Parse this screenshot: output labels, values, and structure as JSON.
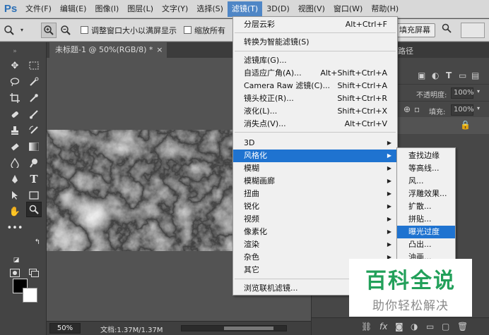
{
  "app": {
    "logo": "Ps"
  },
  "menubar": {
    "items": [
      "文件(F)",
      "编辑(E)",
      "图像(I)",
      "图层(L)",
      "文字(Y)",
      "选择(S)",
      "滤镜(T)",
      "3D(D)",
      "视图(V)",
      "窗口(W)",
      "帮助(H)"
    ],
    "active_index": 6
  },
  "options_bar": {
    "resize_windows_label": "调整窗口大小以满屏显示",
    "zoom_all_label": "缩放所有",
    "fill_screen_label": "填充屏幕"
  },
  "document": {
    "tab_title": "未标题-1 @ 50%(RGB/8) *",
    "close_glyph": "×"
  },
  "status": {
    "zoom": "50%",
    "doc_info": "文档:1.37M/1.37M"
  },
  "right_panel": {
    "tab_label": "路径",
    "opacity_label": "不透明度:",
    "opacity_value": "100%",
    "fill_label": "填充:",
    "fill_value": "100%"
  },
  "filter_menu": {
    "items": [
      {
        "label": "分层云彩",
        "shortcut": "Alt+Ctrl+F"
      },
      {
        "label": "转换为智能滤镜(S)"
      },
      {
        "label": "滤镜库(G)..."
      },
      {
        "label": "自适应广角(A)...",
        "shortcut": "Alt+Shift+Ctrl+A"
      },
      {
        "label": "Camera Raw 滤镜(C)...",
        "shortcut": "Shift+Ctrl+A"
      },
      {
        "label": "镜头校正(R)...",
        "shortcut": "Shift+Ctrl+R"
      },
      {
        "label": "液化(L)...",
        "shortcut": "Shift+Ctrl+X"
      },
      {
        "label": "消失点(V)...",
        "shortcut": "Alt+Ctrl+V"
      },
      {
        "label": "3D"
      },
      {
        "label": "风格化"
      },
      {
        "label": "模糊"
      },
      {
        "label": "模糊画廊"
      },
      {
        "label": "扭曲"
      },
      {
        "label": "锐化"
      },
      {
        "label": "视频"
      },
      {
        "label": "像素化"
      },
      {
        "label": "渲染"
      },
      {
        "label": "杂色"
      },
      {
        "label": "其它"
      },
      {
        "label": "浏览联机滤镜..."
      }
    ]
  },
  "stylize_submenu": {
    "items": [
      "查找边缘",
      "等高线...",
      "风...",
      "浮雕效果...",
      "扩散...",
      "拼贴...",
      "曝光过度",
      "凸出...",
      "油画..."
    ]
  },
  "watermark": {
    "title": "百科全说",
    "subtitle": "助你轻松解决"
  },
  "colors": {
    "menu_highlight": "#1f73d0",
    "watermark_green": "#22a05a",
    "ps_blue": "#2b6fb6"
  }
}
